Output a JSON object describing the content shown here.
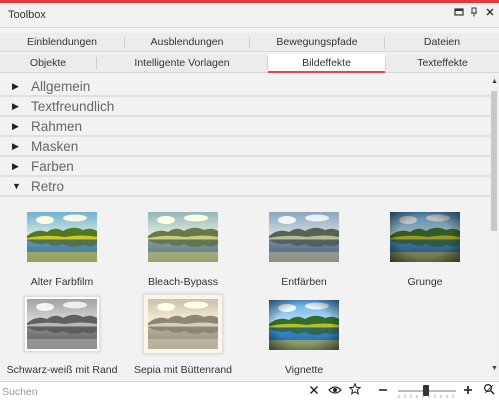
{
  "window": {
    "title": "Toolbox",
    "accent_color": "#e03a3a",
    "controls": [
      "maximize-icon",
      "pin-icon",
      "close-icon"
    ]
  },
  "tabs_row1": [
    {
      "label": "Einblendungen",
      "active": false
    },
    {
      "label": "Ausblendungen",
      "active": false
    },
    {
      "label": "Bewegungspfade",
      "active": false
    },
    {
      "label": "Dateien",
      "active": false
    }
  ],
  "tabs_row2": [
    {
      "label": "Objekte",
      "active": false
    },
    {
      "label": "Intelligente Vorlagen",
      "active": false
    },
    {
      "label": "Bildeffekte",
      "active": true
    },
    {
      "label": "Texteffekte",
      "active": false
    }
  ],
  "active_tab_color": "#e0474c",
  "groups": [
    {
      "label": "Allgemein",
      "expanded": false
    },
    {
      "label": "Textfreundlich",
      "expanded": false
    },
    {
      "label": "Rahmen",
      "expanded": false
    },
    {
      "label": "Masken",
      "expanded": false
    },
    {
      "label": "Farben",
      "expanded": false
    },
    {
      "label": "Retro",
      "expanded": true
    }
  ],
  "effects": [
    {
      "caption": "Alter Farbfilm",
      "style": "oldfilm"
    },
    {
      "caption": "Bleach-Bypass",
      "style": "bleach"
    },
    {
      "caption": "Entfärben",
      "style": "desat"
    },
    {
      "caption": "Grunge",
      "style": "grunge"
    },
    {
      "caption": "Schwarz-weiß mit Rand",
      "style": "bw-frame"
    },
    {
      "caption": "Sepia mit Büttenrand",
      "style": "sepia-frame"
    },
    {
      "caption": "Vignette",
      "style": "vignette"
    }
  ],
  "search": {
    "placeholder": "Suchen",
    "value": ""
  },
  "bottom_icons": [
    "clear-icon",
    "eye-icon",
    "star-icon",
    "zoom-out-icon",
    "zoom-in-icon",
    "filter-icon"
  ],
  "zoom_level": 0.45
}
